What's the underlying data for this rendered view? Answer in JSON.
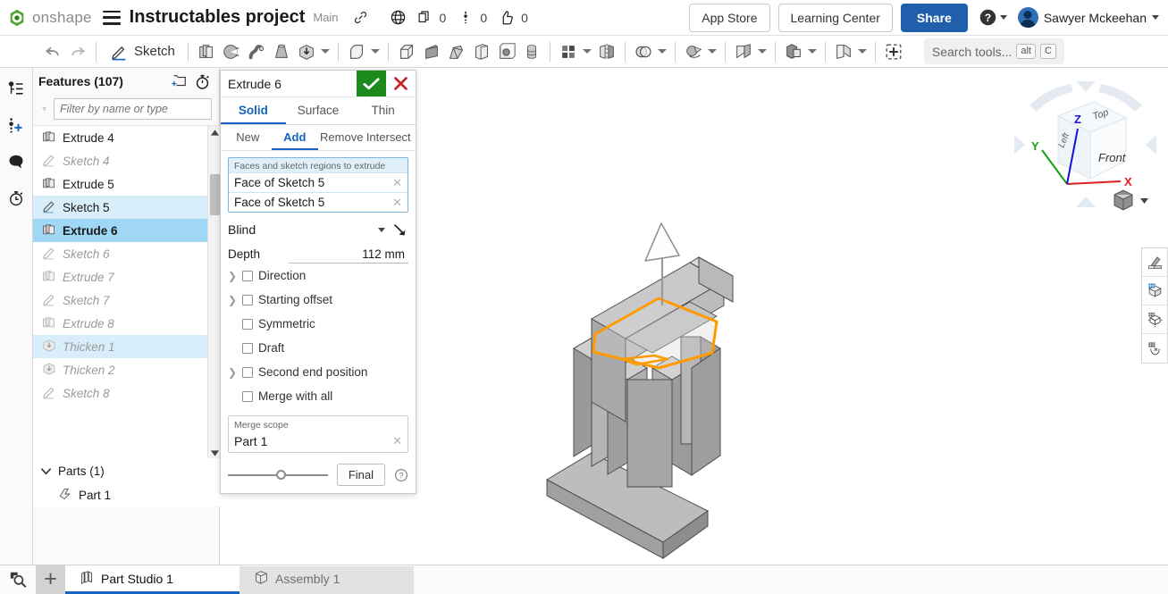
{
  "topbar": {
    "brand": "onshape",
    "menu_icon": "hamburger-menu-icon",
    "document_title": "Instructables project",
    "branch": "Main",
    "link_icon": "link-icon",
    "public_icon": "globe-public-icon",
    "copies_icon": "copy-icon",
    "copies_count": "0",
    "versions_icon": "version-icon",
    "versions_count": "0",
    "likes_icon": "thumbs-up-icon",
    "likes_count": "0",
    "app_store_label": "App Store",
    "learning_center_label": "Learning Center",
    "share_label": "Share",
    "help_icon": "help-circle-icon",
    "user_name": "Sawyer Mckeehan",
    "share_color": "#1f5fab"
  },
  "toolbar": {
    "undo_icon": "undo-arrow-icon",
    "redo_icon": "redo-arrow-icon",
    "sketch_label": "Sketch",
    "sketch_icon": "pencil-sketch-icon",
    "tools": [
      {
        "name": "extrude-tool",
        "icon": "extrude-icon"
      },
      {
        "name": "revolve-tool",
        "icon": "revolve-icon"
      },
      {
        "name": "sweep-tool",
        "icon": "sweep-icon"
      },
      {
        "name": "loft-tool",
        "icon": "loft-icon"
      },
      {
        "name": "thicken-tool",
        "icon": "thicken-box-arrow-icon"
      },
      {
        "name": "fillet-tool",
        "icon": "fillet-icon"
      },
      {
        "name": "chamfer-tool",
        "icon": "chamfer-icon"
      },
      {
        "name": "rib-tool",
        "icon": "rib-icon"
      },
      {
        "name": "draft-tool",
        "icon": "draft-icon"
      },
      {
        "name": "shell-tool",
        "icon": "shell-icon"
      },
      {
        "name": "hole-tool",
        "icon": "hole-icon"
      },
      {
        "name": "thread-tool",
        "icon": "thread-cylinder-icon"
      },
      {
        "name": "pattern-tool",
        "icon": "linear-pattern-icon"
      },
      {
        "name": "mirror-tool",
        "icon": "mirror-icon"
      },
      {
        "name": "boolean-tool",
        "icon": "boolean-union-icon"
      },
      {
        "name": "transform-tool",
        "icon": "transform-move-icon"
      },
      {
        "name": "split-tool",
        "icon": "split-face-icon"
      },
      {
        "name": "composite-part-tool",
        "icon": "composite-part-icon"
      },
      {
        "name": "sheet-metal-tool",
        "icon": "sheet-metal-icon"
      },
      {
        "name": "add-custom-feature",
        "icon": "dashed-plus-icon"
      }
    ],
    "search_placeholder": "Search tools...",
    "search_kbd_alt": "alt",
    "search_kbd_key": "C"
  },
  "rail": {
    "items": [
      {
        "name": "feature-branch-icon",
        "label": "branch"
      },
      {
        "name": "add-version-icon",
        "label": "version"
      },
      {
        "name": "comments-icon",
        "label": "comments"
      },
      {
        "name": "history-icon",
        "label": "history"
      }
    ]
  },
  "tree": {
    "title": "Features (107)",
    "new_folder_icon": "new-folder-icon",
    "rollback_icon": "stopwatch-icon",
    "filter_icon": "funnel-filter-icon",
    "filter_placeholder": "Filter by name or type",
    "features": [
      {
        "label": "Extrude 4",
        "icon": "extrude-feature-icon",
        "state": "normal"
      },
      {
        "label": "Sketch 4",
        "icon": "sketch-feature-icon",
        "state": "grey"
      },
      {
        "label": "Extrude 5",
        "icon": "extrude-feature-icon",
        "state": "normal"
      },
      {
        "label": "Sketch 5",
        "icon": "sketch-feature-icon",
        "state": "light-sel"
      },
      {
        "label": "Extrude 6",
        "icon": "extrude-feature-icon",
        "state": "sel"
      },
      {
        "label": "Sketch 6",
        "icon": "sketch-feature-icon",
        "state": "grey"
      },
      {
        "label": "Extrude 7",
        "icon": "extrude-feature-icon",
        "state": "grey"
      },
      {
        "label": "Sketch 7",
        "icon": "sketch-feature-icon",
        "state": "grey"
      },
      {
        "label": "Extrude 8",
        "icon": "extrude-feature-icon",
        "state": "grey"
      },
      {
        "label": "Thicken 1",
        "icon": "thicken-feature-icon",
        "state": "grey light-sel"
      },
      {
        "label": "Thicken 2",
        "icon": "thicken-feature-icon",
        "state": "grey"
      },
      {
        "label": "Sketch 8",
        "icon": "sketch-feature-icon",
        "state": "grey"
      }
    ],
    "parts_label": "Parts (1)",
    "parts": [
      {
        "label": "Part 1",
        "icon": "part-icon"
      }
    ]
  },
  "dialog": {
    "title": "Extrude 6",
    "accept_icon": "checkmark-icon",
    "cancel_icon": "close-x-icon",
    "main_tabs": [
      {
        "label": "Solid",
        "active": true
      },
      {
        "label": "Surface",
        "active": false
      },
      {
        "label": "Thin",
        "active": false
      }
    ],
    "sub_tabs": [
      {
        "label": "New",
        "active": false
      },
      {
        "label": "Add",
        "active": true
      },
      {
        "label": "Remove",
        "active": false
      },
      {
        "label": "Intersect",
        "active": false
      }
    ],
    "query_label": "Faces and sketch regions to extrude",
    "query_items": [
      "Face of Sketch 5",
      "Face of Sketch 5"
    ],
    "end_type": "Blind",
    "flip_icon": "flip-direction-icon",
    "depth_label": "Depth",
    "depth_value": "112 mm",
    "options": [
      {
        "label": "Direction",
        "chevron": true,
        "checked": false
      },
      {
        "label": "Starting offset",
        "chevron": true,
        "checked": false
      },
      {
        "label": "Symmetric",
        "chevron": false,
        "checked": false
      },
      {
        "label": "Draft",
        "chevron": false,
        "checked": false
      },
      {
        "label": "Second end position",
        "chevron": true,
        "checked": false
      },
      {
        "label": "Merge with all",
        "chevron": false,
        "checked": false
      }
    ],
    "merge_scope_label": "Merge scope",
    "merge_scope_items": [
      "Part 1"
    ],
    "final_label": "Final",
    "help_icon": "question-mark-icon",
    "accent_color": "#1664c0",
    "accept_color": "#1d8a1d",
    "cancel_color": "#cc2020"
  },
  "viewport": {
    "model_name": "extruded-part-model",
    "highlight_color": "#ff9a00",
    "face_light": "#c7c7c7",
    "face_mid": "#a9a9a9",
    "face_dark": "#8e8e8e",
    "direction_arrow_icon": "extrude-direction-arrow"
  },
  "viewcube": {
    "face_top": "Top",
    "face_front": "Front",
    "face_left": "Left",
    "axis_x": "X",
    "axis_y": "Y",
    "axis_z": "Z",
    "axis_x_color": "#e02020",
    "axis_y_color": "#13a313",
    "axis_z_color": "#1414dd",
    "view_menu_icon": "view-cube-menu-icon"
  },
  "right_strip": {
    "buttons": [
      {
        "name": "appearance-icon"
      },
      {
        "name": "display-state-box-icon"
      },
      {
        "name": "render-box-icon"
      },
      {
        "name": "section-view-icon"
      }
    ]
  },
  "bottombar": {
    "zoom_icon": "zoom-search-icon",
    "add_tab_icon": "plus-icon",
    "tabs": [
      {
        "label": "Part Studio 1",
        "icon": "part-studio-icon",
        "active": true
      },
      {
        "label": "Assembly 1",
        "icon": "assembly-icon",
        "active": false
      }
    ]
  }
}
